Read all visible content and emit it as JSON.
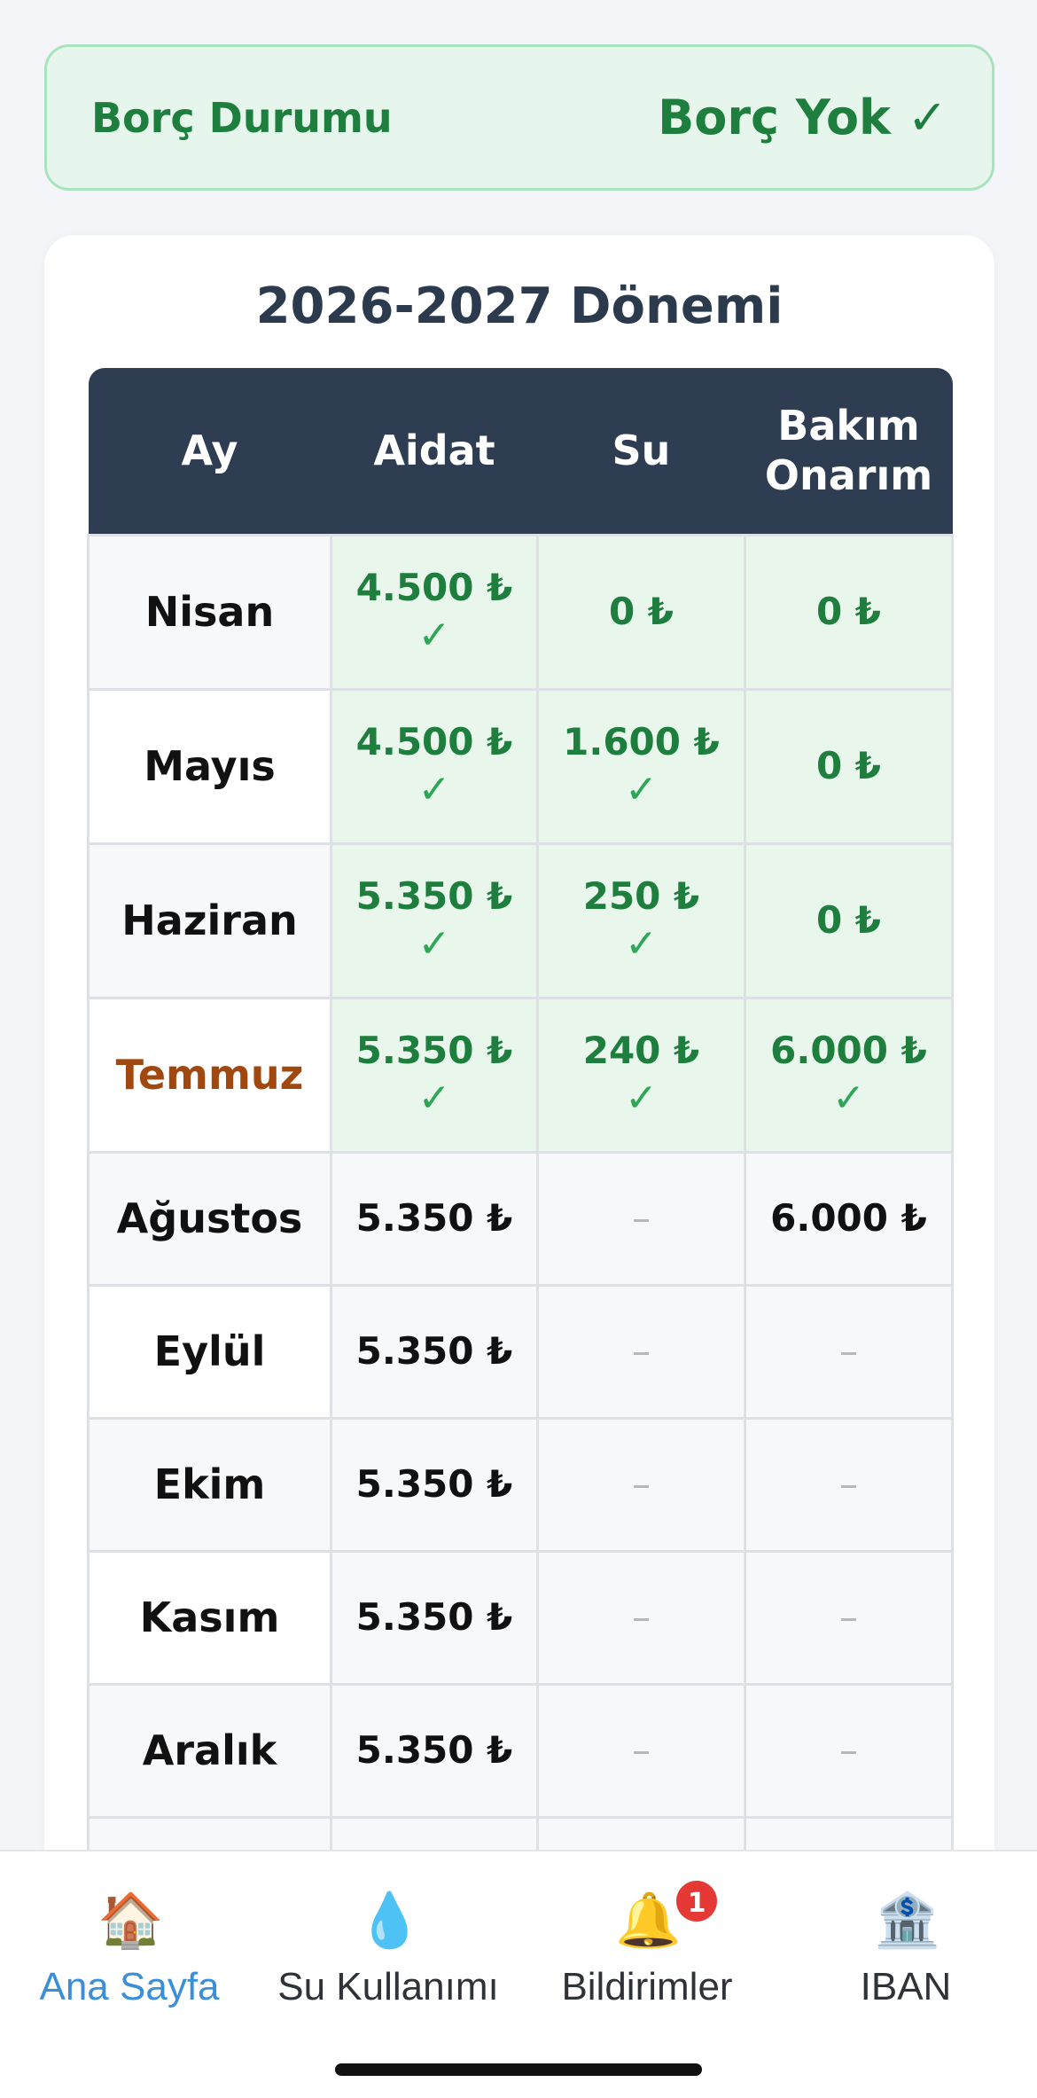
{
  "debt_status": {
    "label": "Borç Durumu",
    "value": "Borç Yok ✓"
  },
  "period": {
    "title": "2026-2027 Dönemi",
    "headers": {
      "month": "Ay",
      "dues": "Aidat",
      "water": "Su",
      "maintenance": "Bakım Onarım"
    },
    "rows": [
      {
        "month": "Nisan",
        "current": false,
        "dues": {
          "amount": "4.500 ₺",
          "paid": true
        },
        "water": {
          "amount": "0 ₺",
          "paid": true,
          "check": false
        },
        "maintenance": {
          "amount": "0 ₺",
          "paid": true,
          "check": false
        }
      },
      {
        "month": "Mayıs",
        "current": false,
        "dues": {
          "amount": "4.500 ₺",
          "paid": true
        },
        "water": {
          "amount": "1.600 ₺",
          "paid": true,
          "check": true
        },
        "maintenance": {
          "amount": "0 ₺",
          "paid": true,
          "check": false
        }
      },
      {
        "month": "Haziran",
        "current": false,
        "dues": {
          "amount": "5.350 ₺",
          "paid": true
        },
        "water": {
          "amount": "250 ₺",
          "paid": true,
          "check": true
        },
        "maintenance": {
          "amount": "0 ₺",
          "paid": true,
          "check": false
        }
      },
      {
        "month": "Temmuz",
        "current": true,
        "dues": {
          "amount": "5.350 ₺",
          "paid": true
        },
        "water": {
          "amount": "240 ₺",
          "paid": true,
          "check": true
        },
        "maintenance": {
          "amount": "6.000 ₺",
          "paid": true,
          "check": true
        }
      },
      {
        "month": "Ağustos",
        "current": false,
        "dues": {
          "amount": "5.350 ₺",
          "paid": false
        },
        "water": {
          "amount": "–",
          "paid": false
        },
        "maintenance": {
          "amount": "6.000 ₺",
          "paid": false
        }
      },
      {
        "month": "Eylül",
        "current": false,
        "dues": {
          "amount": "5.350 ₺",
          "paid": false
        },
        "water": {
          "amount": "–",
          "paid": false
        },
        "maintenance": {
          "amount": "–",
          "paid": false
        }
      },
      {
        "month": "Ekim",
        "current": false,
        "dues": {
          "amount": "5.350 ₺",
          "paid": false
        },
        "water": {
          "amount": "–",
          "paid": false
        },
        "maintenance": {
          "amount": "–",
          "paid": false
        }
      },
      {
        "month": "Kasım",
        "current": false,
        "dues": {
          "amount": "5.350 ₺",
          "paid": false
        },
        "water": {
          "amount": "–",
          "paid": false
        },
        "maintenance": {
          "amount": "–",
          "paid": false
        }
      },
      {
        "month": "Aralık",
        "current": false,
        "dues": {
          "amount": "5.350 ₺",
          "paid": false
        },
        "water": {
          "amount": "–",
          "paid": false
        },
        "maintenance": {
          "amount": "–",
          "paid": false
        }
      }
    ],
    "check_mark": "✓"
  },
  "nav": {
    "items": [
      {
        "label": "Ana Sayfa",
        "icon": "house-icon",
        "glyph": "🏠",
        "active": true
      },
      {
        "label": "Su Kullanımı",
        "icon": "water-drop-icon",
        "glyph": "💧",
        "active": false
      },
      {
        "label": "Bildirimler",
        "icon": "bell-icon",
        "glyph": "🔔",
        "active": false,
        "badge": "1"
      },
      {
        "label": "IBAN",
        "icon": "bank-icon",
        "glyph": "🏦",
        "active": false
      }
    ]
  },
  "colors": {
    "paid_green": "#1e7e3e",
    "check_green": "#2ea655",
    "header_navy": "#2e3d51",
    "current_month": "#a04810",
    "active_nav": "#3a8fd6",
    "badge_red": "#e53935"
  }
}
